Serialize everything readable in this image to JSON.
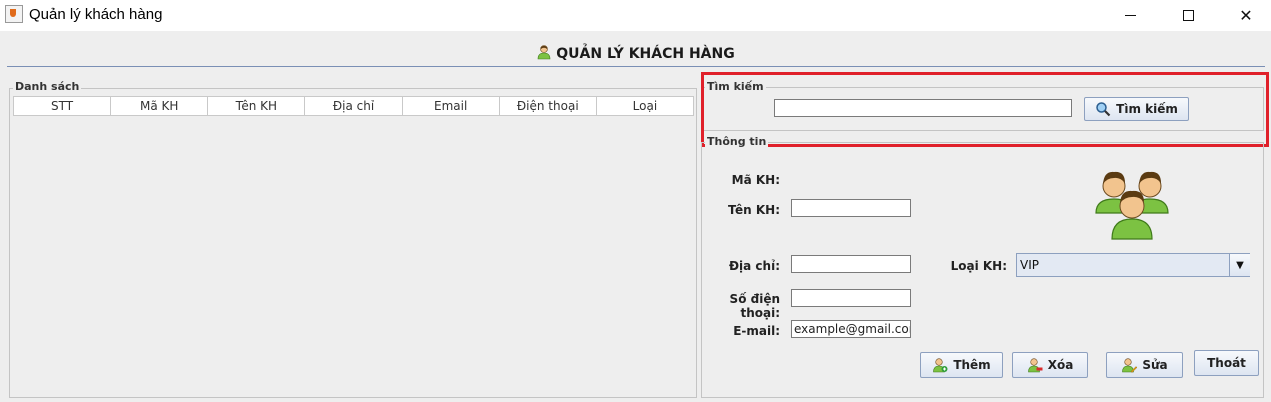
{
  "window": {
    "title": "Quản lý khách hàng"
  },
  "header": {
    "title": "QUẢN LÝ KHÁCH HÀNG"
  },
  "list": {
    "legend": "Danh sách",
    "columns": [
      "STT",
      "Mã KH",
      "Tên KH",
      "Địa chỉ",
      "Email",
      "Điện thoại",
      "Loại"
    ]
  },
  "search": {
    "legend": "Tìm kiếm",
    "input_value": "",
    "button_label": "Tìm kiếm"
  },
  "info": {
    "legend": "Thông tin",
    "ma_kh_label": "Mã KH:",
    "ten_kh_label": "Tên KH:",
    "ten_kh_value": "",
    "dia_chi_label": "Địa chỉ:",
    "dia_chi_value": "",
    "sdt_label": "Số điện thoại:",
    "sdt_value": "",
    "email_label": "E-mail:",
    "email_value": "example@gmail.com",
    "loai_kh_label": "Loại KH:",
    "loai_kh_value": "VIP"
  },
  "buttons": {
    "them": "Thêm",
    "xoa": "Xóa",
    "sua": "Sửa",
    "thoat": "Thoát"
  },
  "icons": {
    "app": "java-cup-icon",
    "header": "user-icon",
    "search": "magnifier-icon",
    "customers": "user-group-icon",
    "them": "user-add-icon",
    "xoa": "user-delete-icon",
    "sua": "user-edit-icon"
  },
  "colors": {
    "highlight": "#e0202a",
    "header_line": "#7a8fb5",
    "avatar_green": "#7cc242",
    "avatar_skin": "#f2c48e"
  }
}
